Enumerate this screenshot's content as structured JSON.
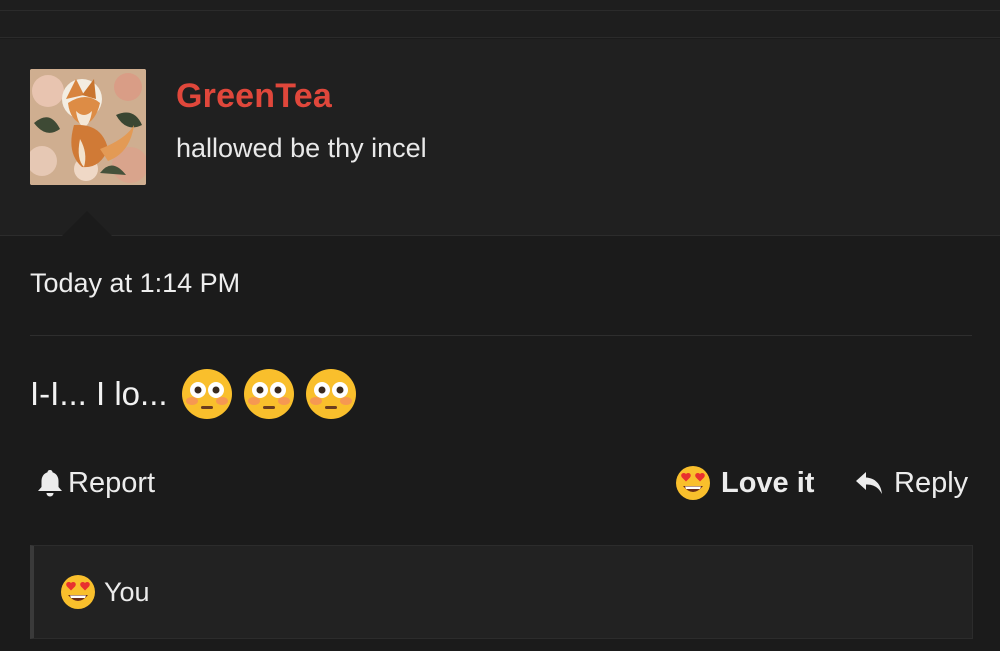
{
  "user": {
    "name": "GreenTea",
    "title": "hallowed be thy incel",
    "name_color": "#e0473b"
  },
  "post": {
    "date": "Today at 1:14 PM",
    "message": "I-I... I lo...",
    "emojis": [
      "flushed-face-emoji",
      "flushed-face-emoji",
      "flushed-face-emoji"
    ]
  },
  "actions": {
    "report_label": "Report",
    "love_label": "Love it",
    "reply_label": "Reply"
  },
  "reactions": {
    "summary": "You",
    "icon": "heart-eyes-emoji"
  }
}
